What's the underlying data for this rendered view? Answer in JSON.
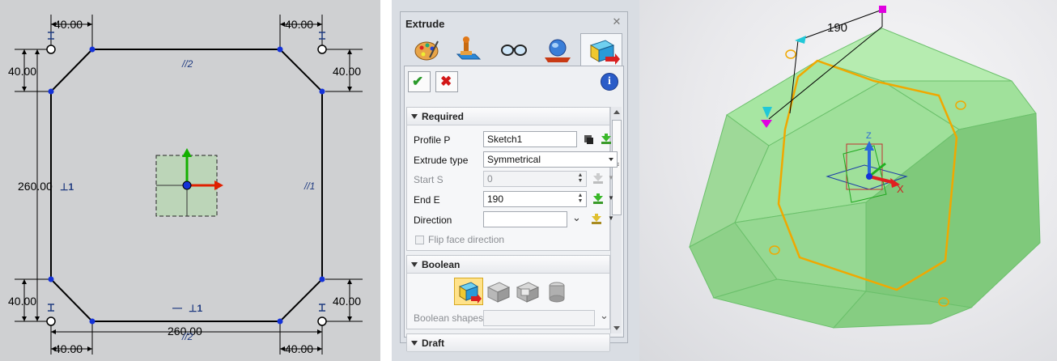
{
  "sketch": {
    "dim_top_left": "40.00",
    "dim_top_right": "40.00",
    "dim_left_upper": "40.00",
    "dim_right_upper": "40.00",
    "dim_left_total": "260.00",
    "dim_left_lower": "40.00",
    "dim_right_lower": "40.00",
    "dim_bottom_total": "260.00",
    "dim_bottom_left": "40.00",
    "dim_bottom_right": "40.00",
    "con_top": "//2",
    "con_right": "//1",
    "con_left": "⊥1",
    "con_bottom_perp": "⊥1",
    "con_bottom_dash": "—",
    "con_bottom_par": "//2"
  },
  "dialog": {
    "title": "Extrude",
    "close_glyph": "✕",
    "tabs": [
      "settings-palette-icon",
      "stamp-icon",
      "glasses-icon",
      "globe-icon",
      "extrude-box-icon"
    ],
    "ok_glyph": "✔",
    "cancel_glyph": "✖",
    "info_glyph": "i",
    "required": {
      "title": "Required",
      "profile_label": "Profile P",
      "profile_value": "Sketch1",
      "type_label": "Extrude type",
      "type_value": "Symmetrical",
      "start_label": "Start S",
      "start_value": "0",
      "end_label": "End E",
      "end_value": "190",
      "direction_label": "Direction",
      "direction_value": "",
      "flip_label": "Flip face direction"
    },
    "boolean": {
      "title": "Boolean",
      "shapes_label": "Boolean shapes",
      "shapes_value": ""
    },
    "draft": {
      "title": "Draft"
    }
  },
  "view3d": {
    "depth_label": "190",
    "axis_x": "X",
    "axis_z": "Z"
  },
  "colors": {
    "sketch_bg": "#cfd0d2",
    "sketch_point": "#1432d8",
    "solid_face": "#8fe08f",
    "profile_edge": "#f0a800",
    "handle_magenta": "#e000e0",
    "handle_cyan": "#20c8d8"
  }
}
